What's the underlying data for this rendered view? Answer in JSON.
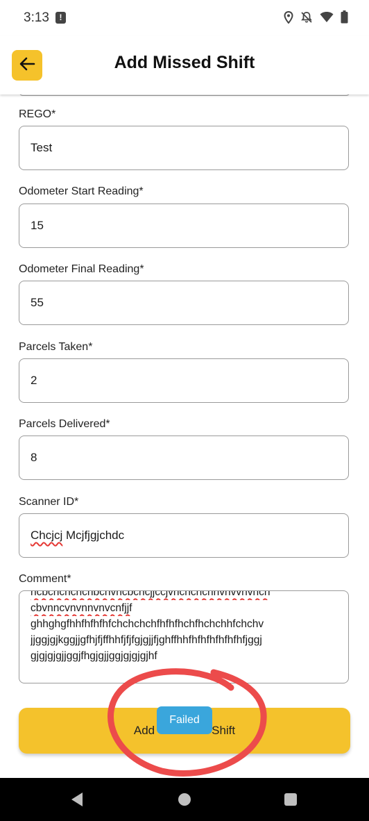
{
  "status_bar": {
    "time": "3:13",
    "alert_glyph": "!",
    "icons": [
      "location-icon",
      "notifications-off-icon",
      "wifi-icon",
      "battery-icon"
    ]
  },
  "header": {
    "title": "Add Missed Shift",
    "back_icon": "arrow-left-icon",
    "accent_color": "#f5c22b"
  },
  "form": {
    "rego": {
      "label": "REGO*",
      "value": "Test"
    },
    "odometer_start": {
      "label": "Odometer Start Reading*",
      "value": "15"
    },
    "odometer_final": {
      "label": "Odometer Final Reading*",
      "value": "55"
    },
    "parcels_taken": {
      "label": "Parcels Taken*",
      "value": "2"
    },
    "parcels_delivered": {
      "label": "Parcels Delivered*",
      "value": "8"
    },
    "scanner_id": {
      "label": "Scanner ID*",
      "value_part1": "Chcjcj",
      "value_part2": " Mcjfjgjchdc"
    },
    "comment": {
      "label": "Comment*",
      "line1": "ncbcncncncnbcnvncbcncjjccjvncncncnnvnvvnvncn",
      "line2": "cbvnncvnvnnvnvcnfjjf",
      "line3": "ghhghgfhhfhfhfhfchchchchfhfhfhchfhchchhfchchv",
      "line4": "jjggjgjkggjjgfhjfjffhhfjfjfgjgjjfjghffhhfhfhfhfhfhfhfjggj",
      "line5": "gjgjgjgjjggjfhgjgjjggjgjgjgjhf"
    },
    "submit_label_left": "Add",
    "submit_label_right": "Shift"
  },
  "toast": {
    "text": "Failed",
    "color": "#3aa6dc"
  },
  "annotation": {
    "color": "#ec4b4b"
  },
  "nav_bar": {
    "icons": [
      "nav-back-icon",
      "nav-home-icon",
      "nav-recents-icon"
    ]
  }
}
